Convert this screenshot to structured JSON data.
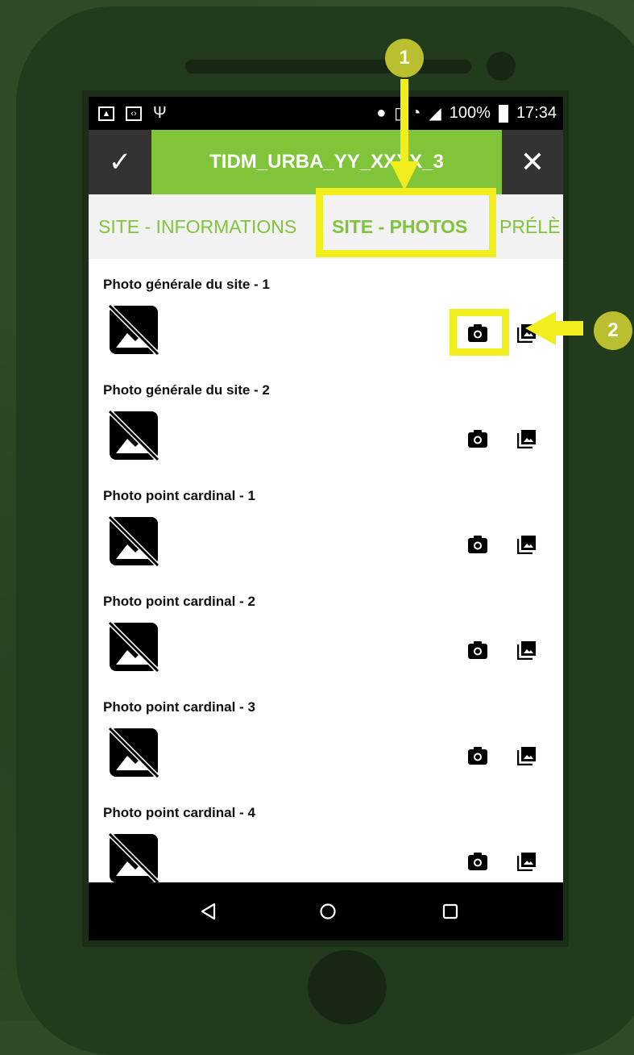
{
  "statusbar": {
    "battery": "100%",
    "time": "17:34"
  },
  "appbar": {
    "title": "TIDM_URBA_YY_XXXX_3"
  },
  "tabs": [
    {
      "label": "SITE - INFORMATIONS"
    },
    {
      "label": "SITE - PHOTOS"
    },
    {
      "label": "PRÉLÈ"
    }
  ],
  "photos": [
    {
      "label": "Photo générale du site - 1"
    },
    {
      "label": "Photo générale du site - 2"
    },
    {
      "label": "Photo point cardinal - 1"
    },
    {
      "label": "Photo point cardinal - 2"
    },
    {
      "label": "Photo point cardinal - 3"
    },
    {
      "label": "Photo point cardinal - 4"
    }
  ],
  "annotations": {
    "badge1": "1",
    "badge2": "2",
    "highlight_color": "#f2ee1e",
    "badge_color": "#b9bf2e"
  },
  "colors": {
    "accent": "#80c43a",
    "phone_body": "#213b1c",
    "background": "#2f4a26"
  }
}
